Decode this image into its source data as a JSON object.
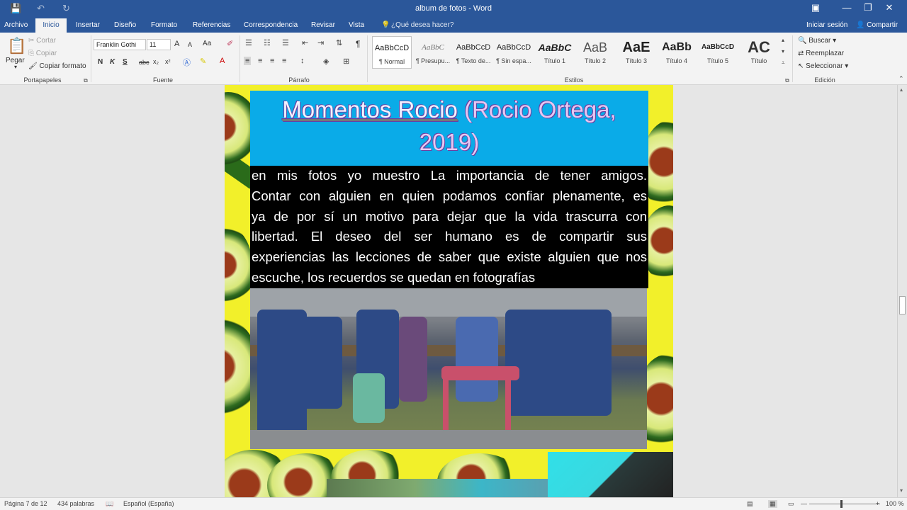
{
  "window": {
    "title": "album de fotos - Word",
    "controls": {
      "ribbon_display": "▣",
      "minimize": "—",
      "restore": "❐",
      "close": "✕"
    }
  },
  "qat": {
    "save_icon": "save-icon",
    "undo_icon": "undo-icon",
    "redo_icon": "redo-icon"
  },
  "tabs": [
    "Archivo",
    "Inicio",
    "Insertar",
    "Diseño",
    "Formato",
    "Referencias",
    "Correspondencia",
    "Revisar",
    "Vista"
  ],
  "active_tab": "Inicio",
  "tell_me": "¿Qué desea hacer?",
  "sign_in": "Iniciar sesión",
  "share": "Compartir",
  "clipboard": {
    "paste": "Pegar",
    "cut": "Cortar",
    "copy": "Copiar",
    "format_painter": "Copiar formato",
    "label": "Portapapeles"
  },
  "font": {
    "family": "Franklin Gothi",
    "size": "11",
    "grow": "A",
    "shrink": "A",
    "case": "Aa",
    "bold": "N",
    "italic": "K",
    "underline": "S",
    "strike": "abc",
    "subscript": "x₂",
    "superscript": "x²",
    "label": "Fuente"
  },
  "paragraph": {
    "label": "Párrafo",
    "pilcrow": "¶"
  },
  "styles": {
    "label": "Estilos",
    "items": [
      {
        "preview": "AaBbCcD",
        "name": "¶ Normal"
      },
      {
        "preview": "AaBbC",
        "name": "¶ Presupu..."
      },
      {
        "preview": "AaBbCcD",
        "name": "¶ Texto de..."
      },
      {
        "preview": "AaBbCcD",
        "name": "¶ Sin espa..."
      },
      {
        "preview": "AaBbC",
        "name": "Título 1"
      },
      {
        "preview": "AaB",
        "name": "Título 2"
      },
      {
        "preview": "AaE",
        "name": "Título 3"
      },
      {
        "preview": "AaBb",
        "name": "Título 4"
      },
      {
        "preview": "AaBbCcD",
        "name": "Título 5"
      },
      {
        "preview": "AC",
        "name": "Título"
      }
    ]
  },
  "editing": {
    "find": "Buscar",
    "replace": "Reemplazar",
    "select": "Seleccionar",
    "label": "Edición"
  },
  "document": {
    "title_part1": "Momentos Rocio",
    "title_part2": "(Rocio Ortega,",
    "title_line2": "2019)",
    "body_lines": [
      "en mis fotos yo muestro La importancia de tener amigos.",
      "Contar con alguien en quien podamos confiar plenamente, es",
      "ya de por sí un motivo para dejar que la vida trascurra con",
      "libertad. El deseo del ser humano es de compartir sus",
      "experiencias las lecciones de saber que existe alguien que nos",
      "escuche, los recuerdos se quedan en fotografías"
    ]
  },
  "status": {
    "page": "Página 7 de 12",
    "words": "434 palabras",
    "language": "Español (España)",
    "zoom": "100 %"
  }
}
